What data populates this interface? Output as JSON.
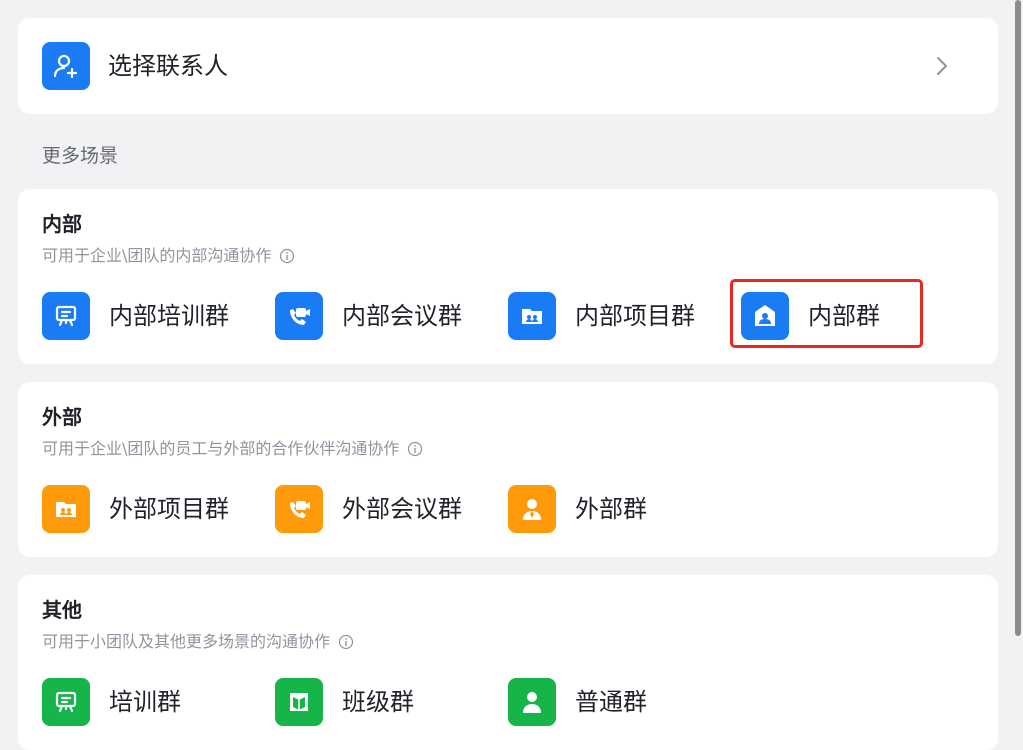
{
  "select_contact": {
    "label": "选择联系人",
    "icon": "add-user-icon",
    "chevron": "chevron-right-icon"
  },
  "more_scenes_label": "更多场景",
  "sections": [
    {
      "title": "内部",
      "desc": "可用于企业\\团队的内部沟通协作",
      "color": "#1a7cf5",
      "items": [
        {
          "label": "内部培训群",
          "icon": "training-board-icon"
        },
        {
          "label": "内部会议群",
          "icon": "video-call-icon"
        },
        {
          "label": "内部项目群",
          "icon": "project-folder-icon"
        },
        {
          "label": "内部群",
          "icon": "internal-group-icon",
          "highlighted": true
        }
      ]
    },
    {
      "title": "外部",
      "desc": "可用于企业\\团队的员工与外部的合作伙伴沟通协作",
      "color": "#ff9a0b",
      "items": [
        {
          "label": "外部项目群",
          "icon": "project-folder-icon"
        },
        {
          "label": "外部会议群",
          "icon": "video-call-icon"
        },
        {
          "label": "外部群",
          "icon": "external-person-icon"
        }
      ]
    },
    {
      "title": "其他",
      "desc": "可用于小团队及其他更多场景的沟通协作",
      "color": "#15b54a",
      "items": [
        {
          "label": "培训群",
          "icon": "training-board-icon"
        },
        {
          "label": "班级群",
          "icon": "class-book-icon"
        },
        {
          "label": "普通群",
          "icon": "person-icon"
        }
      ]
    }
  ]
}
